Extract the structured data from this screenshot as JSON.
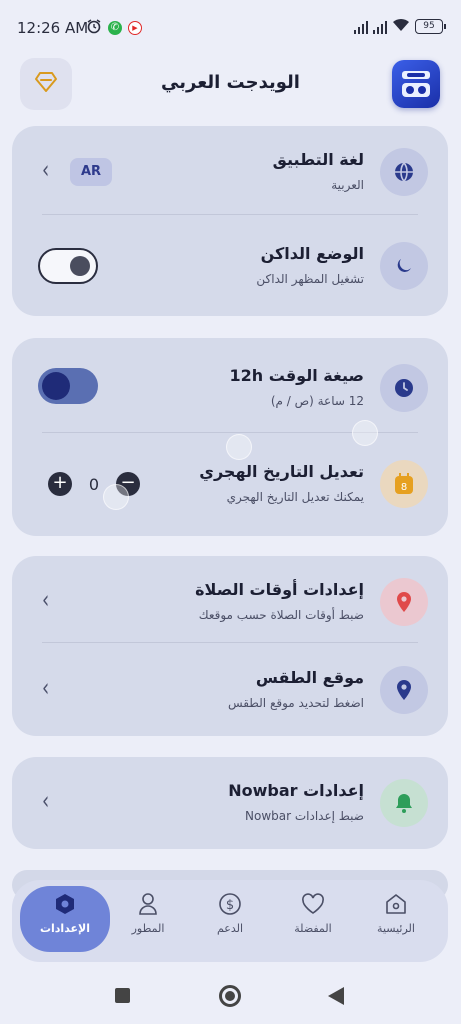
{
  "status_bar": {
    "time": "12:26 AM",
    "battery": "95"
  },
  "header": {
    "title": "الويدجت العربي"
  },
  "card1": {
    "language": {
      "title": "لغة التطبيق",
      "subtitle": "العربية",
      "badge": "AR"
    },
    "dark_mode": {
      "title": "الوضع الداكن",
      "subtitle": "تشغيل المظهر الداكن",
      "enabled": false
    }
  },
  "card2": {
    "time_format": {
      "title": "صيغة الوقت 12h",
      "subtitle": "12 ساعة (ص / م)",
      "enabled": true
    },
    "hijri": {
      "title": "تعديل التاريخ الهجري",
      "subtitle": "يمكنك تعديل التاريخ الهجري",
      "value": "0",
      "plus": "+",
      "minus": "−",
      "calendar_day": "8"
    }
  },
  "card3": {
    "prayer": {
      "title": "إعدادات أوقات الصلاة",
      "subtitle": "ضبط أوقات الصلاة حسب موقعك"
    },
    "weather": {
      "title": "موقع الطقس",
      "subtitle": "اضغط لتحديد موقع الطقس"
    }
  },
  "card4": {
    "nowbar": {
      "title": "إعدادات Nowbar",
      "subtitle": "ضبط إعدادات Nowbar"
    }
  },
  "nav": {
    "items": [
      {
        "label": "الإعدادات",
        "icon": "settings-hex-icon",
        "active": true
      },
      {
        "label": "المطور",
        "icon": "person-icon",
        "active": false
      },
      {
        "label": "الدعم",
        "icon": "dollar-icon",
        "active": false
      },
      {
        "label": "المفضلة",
        "icon": "heart-icon",
        "active": false
      },
      {
        "label": "الرئيسية",
        "icon": "home-icon",
        "active": false
      }
    ]
  },
  "colors": {
    "background": "#eceef8",
    "card": "#d5daea",
    "accent": "#6f84d8",
    "toggle_knob": "#1f2b78",
    "prayer_icon": "#e04a4a",
    "weather_icon": "#2a3a8c",
    "nowbar_icon": "#2e9e5a",
    "calendar_icon": "#e6a020"
  }
}
